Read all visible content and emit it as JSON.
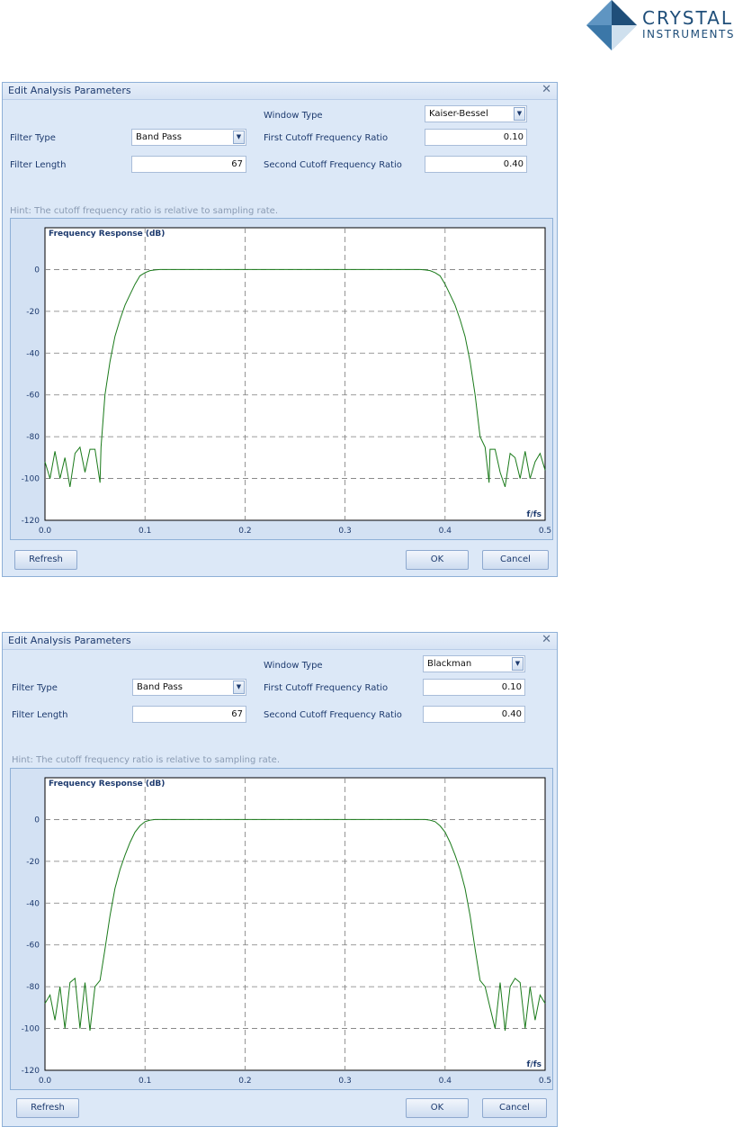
{
  "brand": {
    "line1": "CRYSTAL",
    "line2": "INSTRUMENTS"
  },
  "dialogs": [
    {
      "title": "Edit Analysis Parameters",
      "close_glyph": "✕",
      "window_type_label": "Window Type",
      "window_type_value": "Kaiser-Bessel",
      "filter_type_label": "Filter Type",
      "filter_type_value": "Band Pass",
      "first_cutoff_label": "First Cutoff Frequency Ratio",
      "first_cutoff_value": "0.10",
      "filter_length_label": "Filter Length",
      "filter_length_value": "67",
      "second_cutoff_label": "Second Cutoff Frequency Ratio",
      "second_cutoff_value": "0.40",
      "hint": "Hint: The cutoff frequency ratio is relative to sampling rate.",
      "refresh_label": "Refresh",
      "ok_label": "OK",
      "cancel_label": "Cancel"
    },
    {
      "title": "Edit Analysis Parameters",
      "close_glyph": "✕",
      "window_type_label": "Window Type",
      "window_type_value": "Blackman",
      "filter_type_label": "Filter Type",
      "filter_type_value": "Band Pass",
      "first_cutoff_label": "First Cutoff Frequency Ratio",
      "first_cutoff_value": "0.10",
      "filter_length_label": "Filter Length",
      "filter_length_value": "67",
      "second_cutoff_label": "Second Cutoff Frequency Ratio",
      "second_cutoff_value": "0.40",
      "hint": "Hint: The cutoff frequency ratio is relative to sampling rate.",
      "refresh_label": "Refresh",
      "ok_label": "OK",
      "cancel_label": "Cancel"
    }
  ],
  "chart_data": [
    {
      "type": "line",
      "title": "Frequency Response (dB)",
      "xlabel": "f/fs",
      "ylabel": "",
      "xlim": [
        0,
        0.5
      ],
      "ylim": [
        -120,
        20
      ],
      "xticks": [
        "0.0",
        "0.1",
        "0.2",
        "0.3",
        "0.4",
        "0.5"
      ],
      "yticks": [
        "0",
        "-20",
        "-40",
        "-60",
        "-80",
        "-100",
        "-120"
      ],
      "grid": true,
      "line_color": "#1a7a1a",
      "series": [
        {
          "x": [
            0.0,
            0.005,
            0.01,
            0.015,
            0.02,
            0.025,
            0.03,
            0.035,
            0.04,
            0.045,
            0.05,
            0.055,
            0.056,
            0.06,
            0.065,
            0.07,
            0.075,
            0.08,
            0.085,
            0.09,
            0.095,
            0.1,
            0.105,
            0.11,
            0.115,
            0.12,
            0.125,
            0.13,
            0.2,
            0.3,
            0.37,
            0.375,
            0.38,
            0.385,
            0.39,
            0.395,
            0.4,
            0.405,
            0.41,
            0.415,
            0.42,
            0.425,
            0.43,
            0.435,
            0.44,
            0.444,
            0.445,
            0.45,
            0.455,
            0.46,
            0.465,
            0.47,
            0.475,
            0.48,
            0.485,
            0.49,
            0.495,
            0.5
          ],
          "y": [
            -92,
            -100,
            -87,
            -100,
            -90,
            -104,
            -88,
            -85,
            -97,
            -86,
            -86,
            -102,
            -85,
            -60,
            -44,
            -32,
            -24,
            -17,
            -12,
            -7,
            -3,
            -1.5,
            -0.5,
            -0.2,
            0,
            0,
            0,
            0,
            0,
            0,
            0,
            0,
            -0.2,
            -0.5,
            -1.5,
            -3,
            -7,
            -12,
            -17,
            -24,
            -32,
            -44,
            -60,
            -80,
            -85,
            -102,
            -86,
            -86,
            -97,
            -104,
            -88,
            -90,
            -100,
            -87,
            -100,
            -92,
            -88,
            -96
          ]
        }
      ]
    },
    {
      "type": "line",
      "title": "Frequency Response (dB)",
      "xlabel": "f/fs",
      "ylabel": "",
      "xlim": [
        0,
        0.5
      ],
      "ylim": [
        -120,
        20
      ],
      "xticks": [
        "0.0",
        "0.1",
        "0.2",
        "0.3",
        "0.4",
        "0.5"
      ],
      "yticks": [
        "0",
        "-20",
        "-40",
        "-60",
        "-80",
        "-100",
        "-120"
      ],
      "grid": true,
      "line_color": "#1a7a1a",
      "series": [
        {
          "x": [
            0.0,
            0.005,
            0.01,
            0.015,
            0.02,
            0.025,
            0.03,
            0.035,
            0.04,
            0.045,
            0.05,
            0.055,
            0.06,
            0.065,
            0.07,
            0.075,
            0.08,
            0.085,
            0.09,
            0.095,
            0.1,
            0.105,
            0.11,
            0.115,
            0.12,
            0.2,
            0.3,
            0.38,
            0.385,
            0.39,
            0.395,
            0.4,
            0.405,
            0.41,
            0.415,
            0.42,
            0.425,
            0.43,
            0.435,
            0.44,
            0.445,
            0.45,
            0.455,
            0.46,
            0.465,
            0.47,
            0.475,
            0.48,
            0.485,
            0.49,
            0.495,
            0.5
          ],
          "y": [
            -88,
            -84,
            -96,
            -80,
            -100,
            -78,
            -76,
            -100,
            -78,
            -101,
            -80,
            -77,
            -62,
            -46,
            -33,
            -24,
            -17,
            -11,
            -6,
            -3,
            -1,
            -0.3,
            0,
            0,
            0,
            0,
            0,
            0,
            -0.3,
            -1,
            -3,
            -6,
            -11,
            -17,
            -24,
            -33,
            -46,
            -62,
            -77,
            -80,
            -90,
            -100,
            -78,
            -101,
            -80,
            -76,
            -78,
            -100,
            -80,
            -96,
            -84,
            -88
          ]
        }
      ]
    }
  ]
}
